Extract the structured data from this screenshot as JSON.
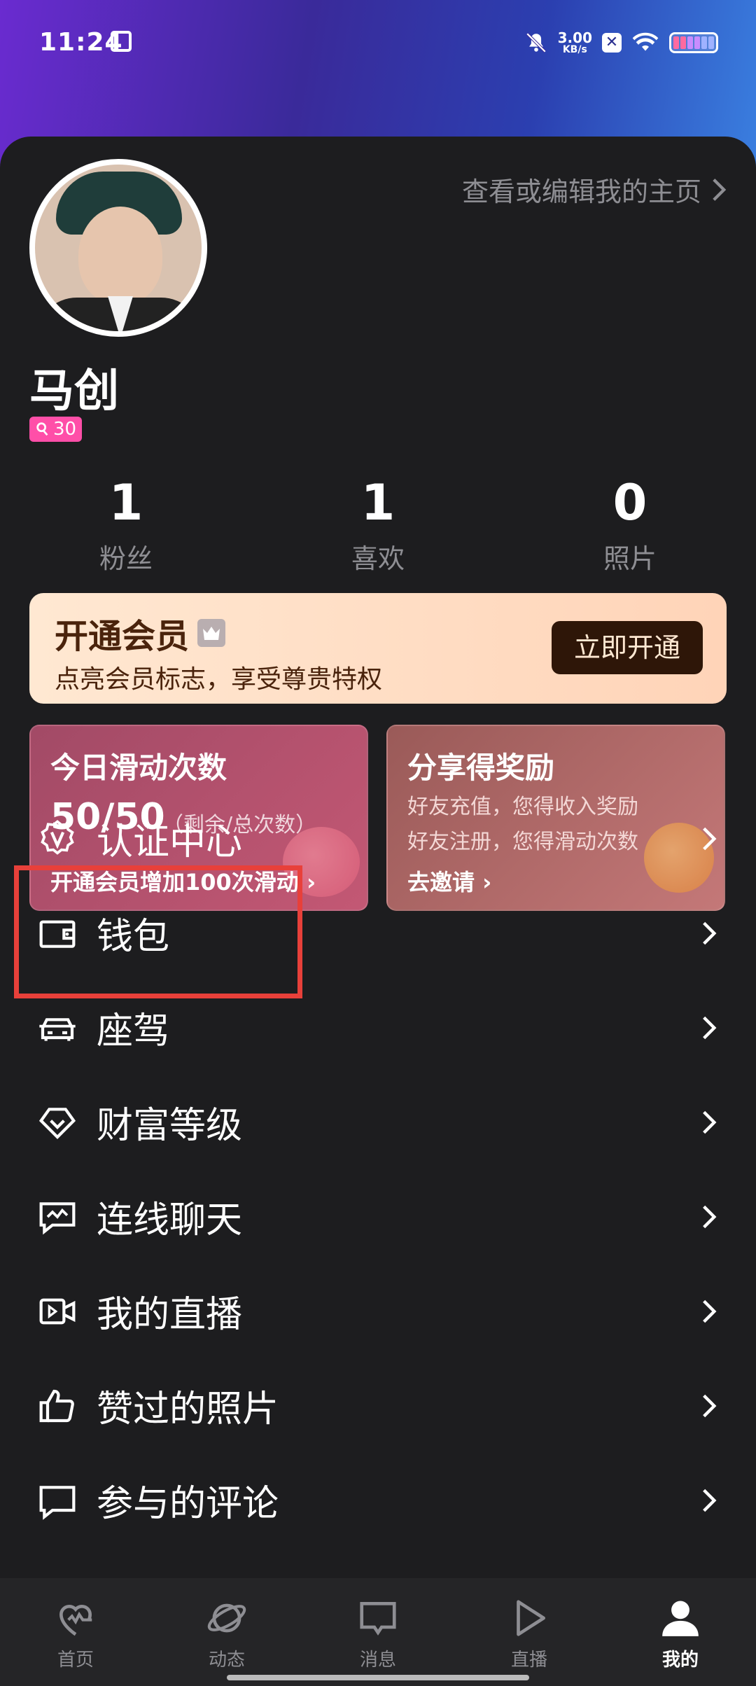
{
  "status_bar": {
    "time": "11:24",
    "net_speed_value": "3.00",
    "net_speed_unit": "KB/s",
    "x_badge": "✕"
  },
  "profile": {
    "edit_link": "查看或编辑我的主页",
    "username": "马创",
    "level": "30"
  },
  "stats": [
    {
      "value": "1",
      "label": "粉丝"
    },
    {
      "value": "1",
      "label": "喜欢"
    },
    {
      "value": "0",
      "label": "照片"
    }
  ],
  "vip": {
    "title": "开通会员",
    "subtitle": "点亮会员标志，享受尊贵特权",
    "button": "立即开通"
  },
  "cards": {
    "swipes": {
      "title": "今日滑动次数",
      "count": "50/50",
      "count_note": "（剩余/总次数）",
      "link": "开通会员增加100次滑动 ›"
    },
    "share": {
      "title": "分享得奖励",
      "line1": "好友充值，您得收入奖励",
      "line2": "好友注册，您得滑动次数",
      "link": "去邀请 ›"
    }
  },
  "menu": [
    {
      "label": "认证中心",
      "icon": "verify-badge-icon"
    },
    {
      "label": "钱包",
      "icon": "wallet-icon"
    },
    {
      "label": "座驾",
      "icon": "car-icon"
    },
    {
      "label": "财富等级",
      "icon": "diamond-icon"
    },
    {
      "label": "连线聊天",
      "icon": "chat-line-icon"
    },
    {
      "label": "我的直播",
      "icon": "video-camera-icon"
    },
    {
      "label": "赞过的照片",
      "icon": "thumbs-up-icon"
    },
    {
      "label": "参与的评论",
      "icon": "comment-icon"
    }
  ],
  "tabs": [
    {
      "label": "首页",
      "icon": "heart-icon"
    },
    {
      "label": "动态",
      "icon": "planet-icon"
    },
    {
      "label": "消息",
      "icon": "message-icon"
    },
    {
      "label": "直播",
      "icon": "play-icon"
    },
    {
      "label": "我的",
      "icon": "person-icon",
      "active": true
    }
  ],
  "colors": {
    "accent_pink": "#ff4fa8",
    "highlight_red": "#e8403a",
    "vip_dark": "#2e1608"
  }
}
